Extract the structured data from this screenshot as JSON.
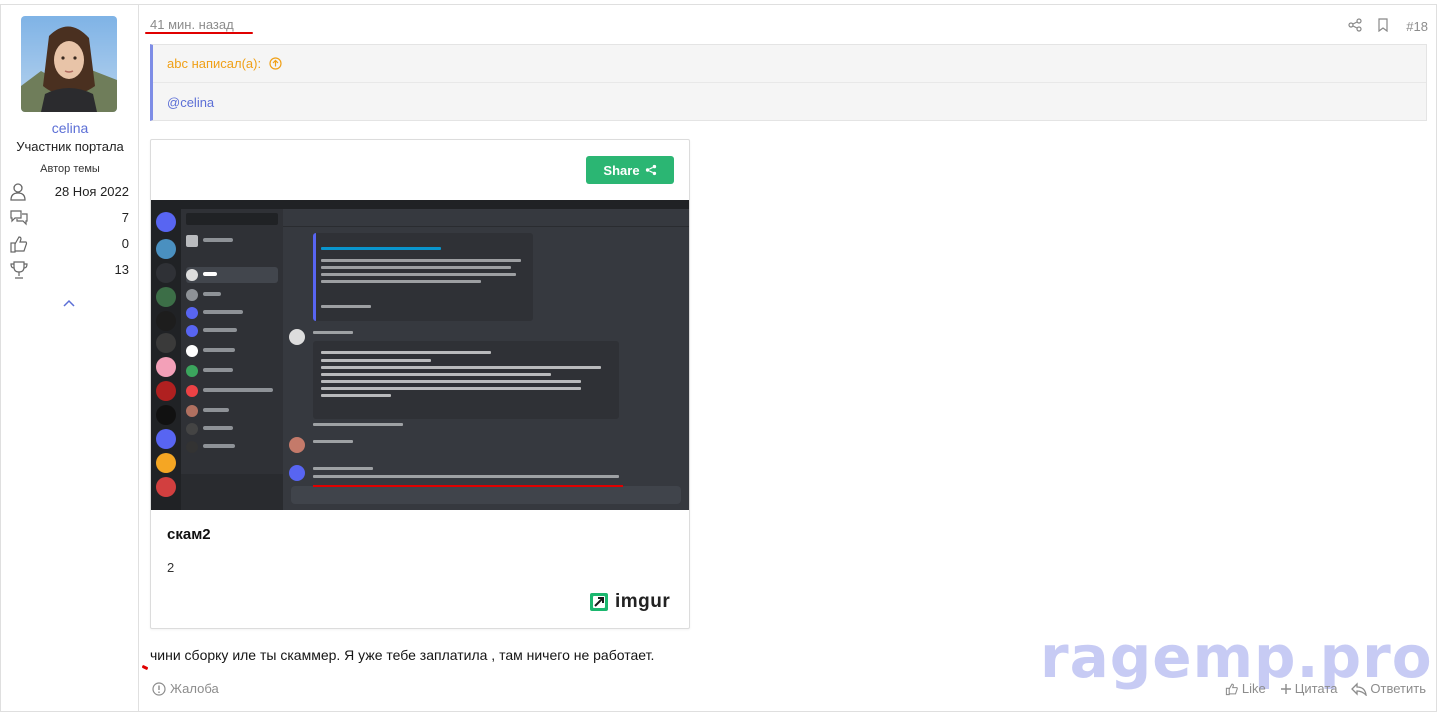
{
  "post": {
    "time": "41 мин. назад",
    "number": "#18",
    "user": {
      "name": "celina",
      "title": "Участник портала",
      "badge": "Автор темы",
      "stats": [
        {
          "icon": "user-icon",
          "value": "28 Ноя 2022"
        },
        {
          "icon": "messages-icon",
          "value": "7"
        },
        {
          "icon": "thumbs-up-icon",
          "value": "0"
        },
        {
          "icon": "trophy-icon",
          "value": "13"
        }
      ]
    },
    "quote": {
      "author": "abc написал(а):",
      "body": "@celina"
    },
    "embed": {
      "share_label": "Share",
      "title": "скам2",
      "description": "2",
      "provider": "imgur"
    },
    "message": "чини сборку иле ты скаммер. Я уже тебе заплатила , там ничего не работает.",
    "footer": {
      "complaint": "Жалоба",
      "like": "Like",
      "quote": "Цитата",
      "reply": "Ответить"
    },
    "watermark": "ragemp.pro"
  },
  "colors": {
    "accent": "#5c6fd6",
    "quote_author": "#f0a017",
    "share_green": "#2bb673",
    "muted": "#8c8c8c",
    "annotation_red": "#e00000"
  }
}
